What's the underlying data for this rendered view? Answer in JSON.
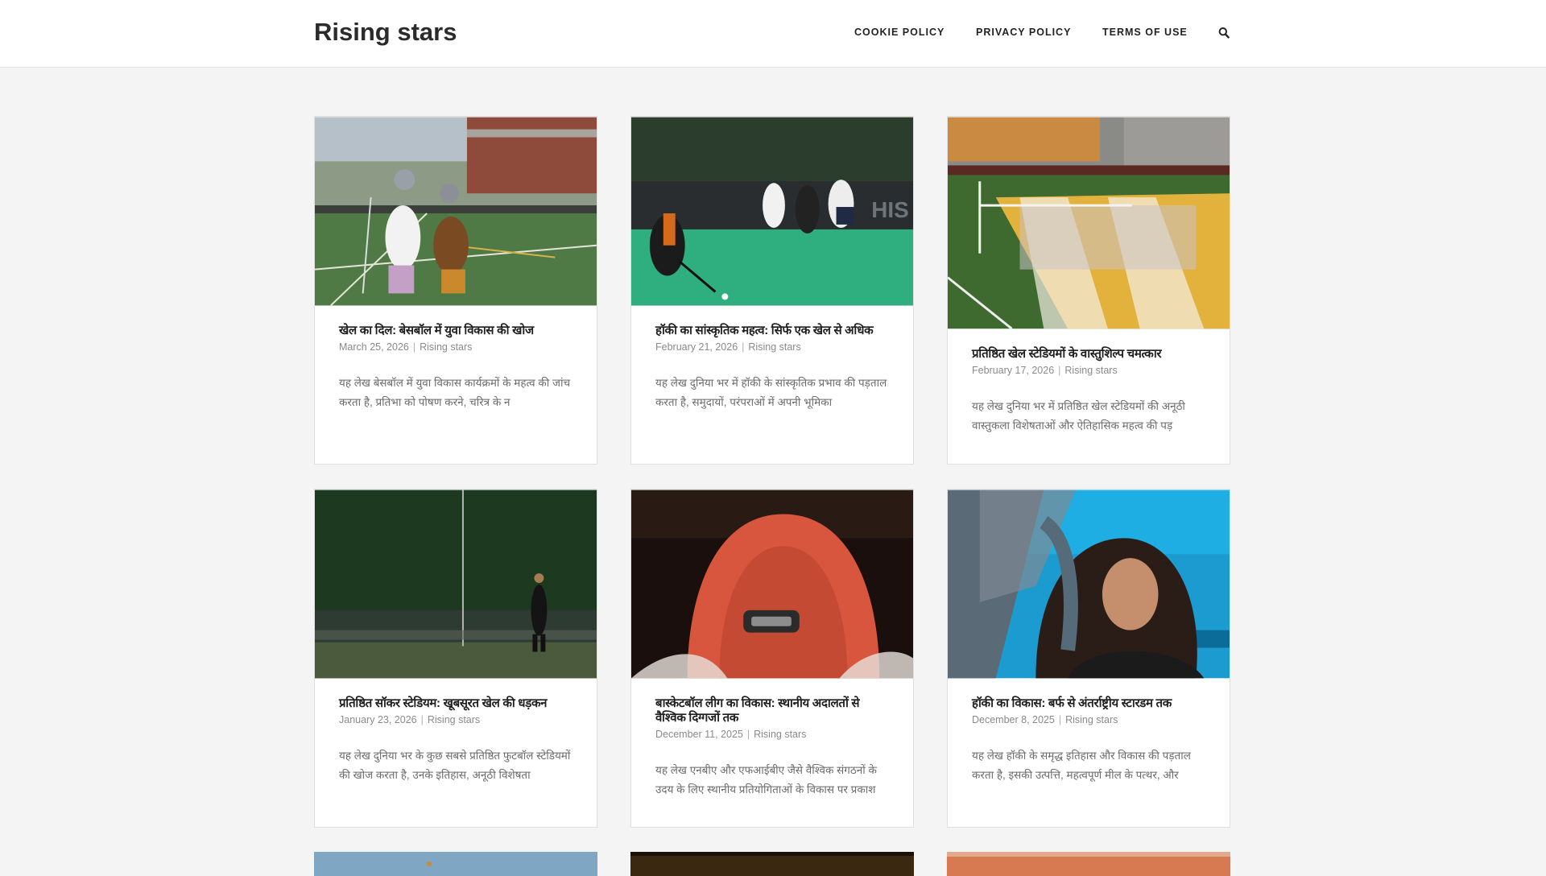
{
  "header": {
    "site_title": "Rising stars",
    "nav": [
      "COOKIE POLICY",
      "PRIVACY POLICY",
      "TERMS OF USE"
    ],
    "search_icon": "search-icon"
  },
  "posts": [
    {
      "title": "खेल का दिल: बेसबॉल में युवा विकास की खोज",
      "date": "March 25, 2026",
      "category": "Rising stars",
      "excerpt": "यह लेख बेसबॉल में युवा विकास कार्यक्रमों के महत्व की जांच करता है, प्रतिभा को पोषण करने, चरित्र के न",
      "image": "lacrosse-players-photo"
    },
    {
      "title": "हॉकी का सांस्कृतिक महत्व: सिर्फ एक खेल से अधिक",
      "date": "February 21, 2026",
      "category": "Rising stars",
      "excerpt": "यह लेख दुनिया भर में हॉकी के सांस्कृतिक प्रभाव की पड़ताल करता है, समुदायों, परंपराओं में अपनी भूमिका",
      "image": "field-hockey-players-photo"
    },
    {
      "title": "प्रतिष्ठित खेल स्टेडियमों के वास्तुशिल्प चमत्कार",
      "date": "February 17, 2026",
      "category": "Rising stars",
      "excerpt": "यह लेख दुनिया भर में प्रतिष्ठित खेल स्टेडियमों की अनूठी वास्तुकला विशेषताओं और ऐतिहासिक महत्व की पड़",
      "image": "football-stadium-photo"
    },
    {
      "title": "प्रतिष्ठित सॉकर स्टेडियम: खूबसूरत खेल की धड़कन",
      "date": "January 23, 2026",
      "category": "Rising stars",
      "excerpt": "यह लेख दुनिया भर के कुछ सबसे प्रतिष्ठित फुटबॉल स्टेडियमों की खोज करता है, उनके इतिहास, अनूठी विशेषता",
      "image": "soccer-field-photo"
    },
    {
      "title": "बास्केटबॉल लीग का विकास: स्थानीय अदालतों से वैश्विक दिग्गजों तक",
      "date": "December 11, 2025",
      "category": "Rising stars",
      "excerpt": "यह लेख एनबीए और एफआईबीए जैसे वैश्विक संगठनों के उदय के लिए स्थानीय प्रतियोगिताओं के विकास पर प्रकाश",
      "image": "car-seat-photo"
    },
    {
      "title": "हॉकी का विकास: बर्फ से अंतर्राष्ट्रीय स्टारडम तक",
      "date": "December 8, 2025",
      "category": "Rising stars",
      "excerpt": "यह लेख हॉकी के समृद्ध इतिहास और विकास की पड़ताल करता है, इसकी उत्पत्ति, महत्वपूर्ण मील के पत्थर, और",
      "image": "woman-portrait-photo"
    }
  ],
  "colors": {
    "background": "#f4f4f4",
    "card": "#ffffff",
    "border": "#e0e0e0",
    "title_text": "#1f1f1f",
    "meta_text": "#8a8a8a"
  }
}
